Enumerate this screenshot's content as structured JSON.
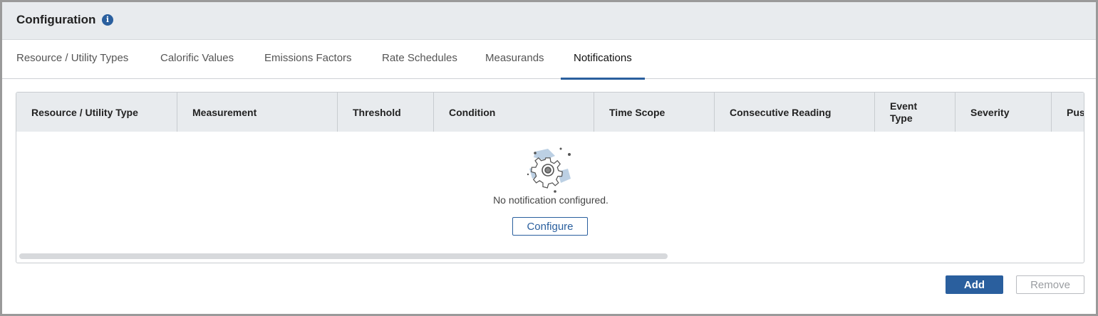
{
  "header": {
    "title": "Configuration",
    "info_icon": "i"
  },
  "tabs": [
    {
      "label": "Resource / Utility Types"
    },
    {
      "label": "Calorific Values"
    },
    {
      "label": "Emissions Factors"
    },
    {
      "label": "Rate Schedules"
    },
    {
      "label": "Measurands"
    },
    {
      "label": "Notifications",
      "active": true
    }
  ],
  "grid": {
    "columns": [
      {
        "label": "Resource / Utility Type"
      },
      {
        "label": "Measurement"
      },
      {
        "label": "Threshold"
      },
      {
        "label": "Condition"
      },
      {
        "label": "Time Scope"
      },
      {
        "label": "Consecutive Reading"
      },
      {
        "label": "Event Type"
      },
      {
        "label": "Severity"
      },
      {
        "label": "Pus"
      }
    ],
    "empty_message": "No notification configured.",
    "configure_label": "Configure"
  },
  "actions": {
    "add_label": "Add",
    "remove_label": "Remove"
  },
  "colors": {
    "accent": "#2a5f9e",
    "header_bg": "#e8ebee",
    "border": "#c8ccd0"
  }
}
